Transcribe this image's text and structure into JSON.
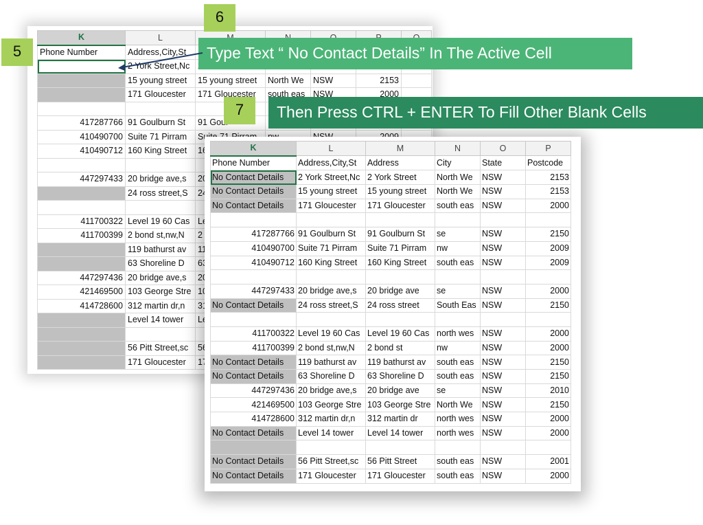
{
  "steps": {
    "step5": "5",
    "step6": "6",
    "step7": "7"
  },
  "banners": {
    "banner6": "Type Text “ No Contact Details” In The Active Cell",
    "banner7": "Then Press CTRL + ENTER To Fill Other Blank Cells"
  },
  "colors": {
    "excel_green": "#217346",
    "step_badge": "#a6d05a",
    "banner6_bg": "#4bb577",
    "banner7_bg": "#2b8a5e",
    "blank_cell_grey": "#c0c0c0"
  },
  "back_sheet": {
    "columns": [
      "K",
      "L",
      "M",
      "N",
      "O",
      "P",
      "Q"
    ],
    "rows": [
      [
        "Phone Number",
        "Address,City,St",
        "",
        "",
        "",
        "",
        ""
      ],
      [
        "",
        "2 York Street,Nc",
        "2",
        "",
        "",
        "",
        ""
      ],
      [
        "",
        "15 young street",
        "15 young street",
        "North We",
        "NSW",
        "2153",
        ""
      ],
      [
        "",
        "171 Gloucester",
        "171 Gloucester",
        "south eas",
        "NSW",
        "2000",
        ""
      ],
      [
        "",
        "",
        "",
        "",
        "",
        "",
        ""
      ],
      [
        "417287766",
        "91 Goulburn St",
        "91 Goul",
        "",
        "",
        "",
        ""
      ],
      [
        "410490700",
        "Suite 71 Pirram",
        "Suite 71 Pirram",
        "nw",
        "NSW",
        "2009",
        ""
      ],
      [
        "410490712",
        "160 King Street",
        "16",
        "",
        "",
        "",
        ""
      ],
      [
        "",
        "",
        "",
        "",
        "",
        "",
        ""
      ],
      [
        "447297433",
        "20 bridge ave,s",
        "20",
        "",
        "",
        "",
        ""
      ],
      [
        "",
        "24 ross street,S",
        "24",
        "",
        "",
        "",
        ""
      ],
      [
        "",
        "",
        "",
        "",
        "",
        "",
        ""
      ],
      [
        "411700322",
        "Level 19 60 Cas",
        "Le",
        "",
        "",
        "",
        ""
      ],
      [
        "411700399",
        "2 bond st,nw,N",
        "2",
        "",
        "",
        "",
        ""
      ],
      [
        "",
        "119 bathurst av",
        "11",
        "",
        "",
        "",
        ""
      ],
      [
        "",
        "63 Shoreline D",
        "63",
        "",
        "",
        "",
        ""
      ],
      [
        "447297436",
        "20 bridge ave,s",
        "20",
        "",
        "",
        "",
        ""
      ],
      [
        "421469500",
        "103 George Stre",
        "10",
        "",
        "",
        "",
        ""
      ],
      [
        "414728600",
        "312 martin dr,n",
        "31",
        "",
        "",
        "",
        ""
      ],
      [
        "",
        "Level 14 tower",
        "Le",
        "",
        "",
        "",
        ""
      ],
      [
        "",
        "",
        "",
        "",
        "",
        "",
        ""
      ],
      [
        "",
        "56 Pitt Street,sc",
        "56",
        "",
        "",
        "",
        ""
      ],
      [
        "",
        "171 Gloucester",
        "17",
        "",
        "",
        "",
        ""
      ]
    ]
  },
  "front_sheet": {
    "columns": [
      "K",
      "L",
      "M",
      "N",
      "O",
      "P"
    ],
    "rows": [
      [
        "Phone Number",
        "Address,City,St",
        "Address",
        "City",
        "State",
        "Postcode"
      ],
      [
        "No Contact Details",
        "2 York Street,Nc",
        "2 York Street",
        "North We",
        "NSW",
        "2153"
      ],
      [
        "No Contact Details",
        "15 young street",
        "15 young street",
        "North We",
        "NSW",
        "2153"
      ],
      [
        "No Contact Details",
        "171 Gloucester",
        "171 Gloucester",
        "south eas",
        "NSW",
        "2000"
      ],
      [
        "",
        "",
        "",
        "",
        "",
        ""
      ],
      [
        "417287766",
        "91 Goulburn St",
        "91 Goulburn St",
        "se",
        "NSW",
        "2150"
      ],
      [
        "410490700",
        "Suite 71 Pirram",
        "Suite 71 Pirram",
        "nw",
        "NSW",
        "2009"
      ],
      [
        "410490712",
        "160 King Street",
        "160 King Street",
        "south eas",
        "NSW",
        "2009"
      ],
      [
        "",
        "",
        "",
        "",
        "",
        ""
      ],
      [
        "447297433",
        "20 bridge ave,s",
        "20 bridge ave",
        "se",
        "NSW",
        "2000"
      ],
      [
        "No Contact Details",
        "24 ross street,S",
        "24 ross street",
        "South Eas",
        "NSW",
        "2150"
      ],
      [
        "",
        "",
        "",
        "",
        "",
        ""
      ],
      [
        "411700322",
        "Level 19 60 Cas",
        "Level 19 60 Cas",
        "north wes",
        "NSW",
        "2000"
      ],
      [
        "411700399",
        "2 bond st,nw,N",
        "2 bond st",
        "nw",
        "NSW",
        "2000"
      ],
      [
        "No Contact Details",
        "119 bathurst av",
        "119 bathurst av",
        "south eas",
        "NSW",
        "2150"
      ],
      [
        "No Contact Details",
        "63 Shoreline D",
        "63 Shoreline D",
        "south eas",
        "NSW",
        "2150"
      ],
      [
        "447297436",
        "20 bridge ave,s",
        "20 bridge ave",
        "se",
        "NSW",
        "2010"
      ],
      [
        "421469500",
        "103 George Stre",
        "103 George Stre",
        "North We",
        "NSW",
        "2150"
      ],
      [
        "414728600",
        "312 martin dr,n",
        "312 martin dr",
        "north wes",
        "NSW",
        "2000"
      ],
      [
        "No Contact Details",
        "Level 14 tower",
        "Level 14 tower",
        "north wes",
        "NSW",
        "2000"
      ],
      [
        "",
        "",
        "",
        "",
        "",
        ""
      ],
      [
        "No Contact Details",
        "56 Pitt Street,sc",
        "56 Pitt Street",
        "south eas",
        "NSW",
        "2001"
      ],
      [
        "No Contact Details",
        "171 Gloucester",
        "171 Gloucester",
        "south eas",
        "NSW",
        "2000"
      ]
    ]
  }
}
